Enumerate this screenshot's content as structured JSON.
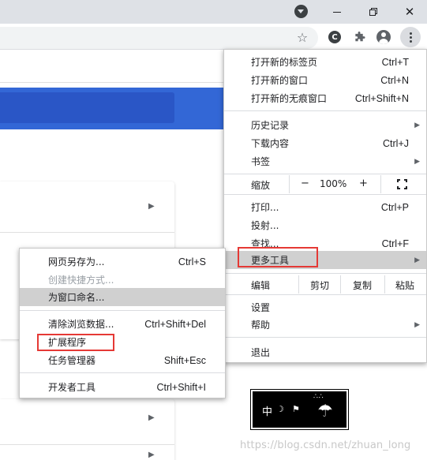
{
  "window_controls": {
    "tab_search_icon": "chevron-down-icon",
    "minimize_icon": "minimize-icon",
    "restore_icon": "restore-icon",
    "close_glyph": "✕"
  },
  "toolbar": {
    "bookmark_star": "☆",
    "extension_badge": "C",
    "extensions_icon": "puzzle-icon",
    "profile_icon": "profile-icon",
    "menu_icon": "three-dot-menu-icon"
  },
  "menu": {
    "sections": [
      [
        {
          "label": "打开新的标签页",
          "shortcut": "Ctrl+T"
        },
        {
          "label": "打开新的窗口",
          "shortcut": "Ctrl+N"
        },
        {
          "label": "打开新的无痕窗口",
          "shortcut": "Ctrl+Shift+N"
        }
      ],
      [
        {
          "label": "历史记录",
          "shortcut": ""
        },
        {
          "label": "下载内容",
          "shortcut": "Ctrl+J"
        },
        {
          "label": "书签",
          "shortcut": ""
        }
      ]
    ],
    "zoom": {
      "label": "缩放",
      "minus": "−",
      "value": "100%",
      "plus": "+"
    },
    "tools": [
      {
        "label": "打印...",
        "shortcut": "Ctrl+P"
      },
      {
        "label": "投射...",
        "shortcut": ""
      },
      {
        "label": "查找...",
        "shortcut": "Ctrl+F"
      },
      {
        "label": "更多工具",
        "shortcut": ""
      }
    ],
    "edit": {
      "label": "编辑",
      "cut": "剪切",
      "copy": "复制",
      "paste": "粘贴"
    },
    "settings": [
      {
        "label": "设置",
        "shortcut": ""
      },
      {
        "label": "帮助",
        "shortcut": ""
      }
    ],
    "exit": {
      "label": "退出"
    }
  },
  "submenu": {
    "items": [
      {
        "label": "网页另存为...",
        "shortcut": "Ctrl+S"
      },
      {
        "label": "创建快捷方式...",
        "shortcut": ""
      },
      {
        "label": "为窗口命名...",
        "shortcut": ""
      },
      {
        "label": "清除浏览数据...",
        "shortcut": "Ctrl+Shift+Del"
      },
      {
        "label": "扩展程序",
        "shortcut": ""
      },
      {
        "label": "任务管理器",
        "shortcut": "Shift+Esc"
      },
      {
        "label": "开发者工具",
        "shortcut": "Ctrl+Shift+I"
      }
    ]
  },
  "page": {
    "logo_text": "中",
    "watermark": "https://blog.csdn.net/zhuan_long"
  },
  "colors": {
    "highlight": "#d0d0d0",
    "annotation_red": "#e53935",
    "brand_blue": "#3367d6"
  }
}
